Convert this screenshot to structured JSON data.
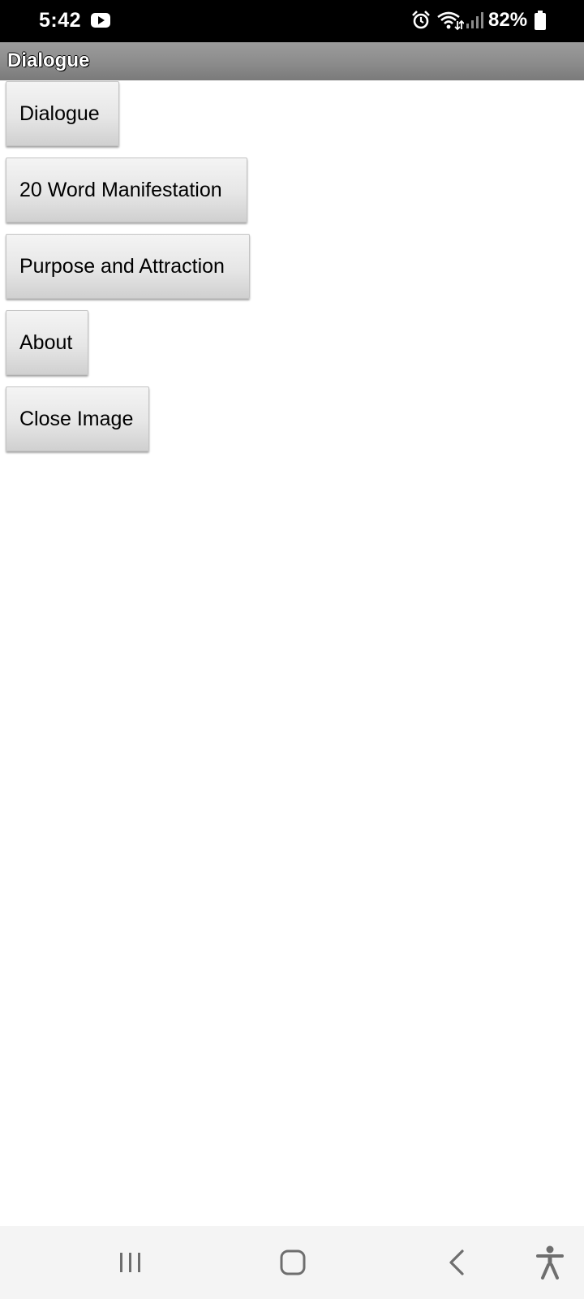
{
  "status_bar": {
    "time": "5:42",
    "battery": "82%",
    "icons": [
      "youtube-icon",
      "alarm-icon",
      "wifi-icon",
      "signal-icon",
      "battery-icon"
    ]
  },
  "title_bar": {
    "title": "Dialogue"
  },
  "buttons": [
    {
      "label": "Dialogue"
    },
    {
      "label": "20 Word Manifestation"
    },
    {
      "label": "Purpose and Attraction"
    },
    {
      "label": "About"
    },
    {
      "label": "Close Image"
    }
  ],
  "nav_bar": {
    "icons": [
      "recents-icon",
      "home-icon",
      "back-icon",
      "accessibility-icon"
    ]
  },
  "colors": {
    "status_bar_bg": "#000000",
    "title_bar_bg": "#8a8a8a",
    "button_bg": "#e6e6e6",
    "nav_bar_bg": "#f4f4f4",
    "nav_icon": "#6e6e6e"
  }
}
